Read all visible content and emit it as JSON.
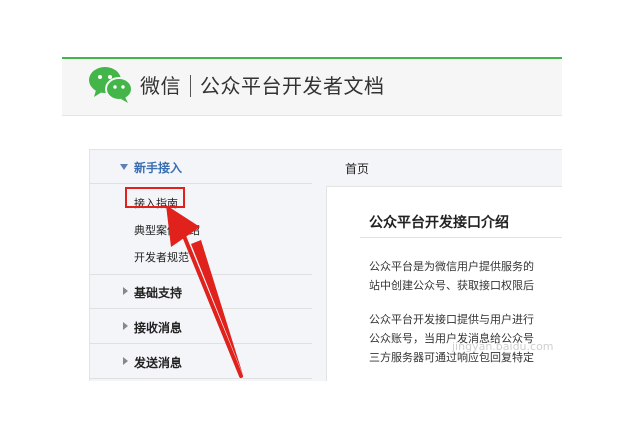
{
  "header": {
    "brand_name": "微信",
    "site_title": "公众平台开发者文档"
  },
  "sidebar": {
    "sections": [
      {
        "label": "新手接入",
        "expanded": true
      },
      {
        "label": "基础支持",
        "expanded": false
      },
      {
        "label": "接收消息",
        "expanded": false
      },
      {
        "label": "发送消息",
        "expanded": false
      }
    ],
    "sub_items": [
      "接入指南",
      "典型案例介绍",
      "开发者规范"
    ],
    "highlighted_item": "接入指南"
  },
  "content": {
    "breadcrumb": "首页",
    "title": "公众平台开发接口介绍",
    "paragraphs": [
      "公众平台是为微信用户提供服务的",
      "站中创建公众号、获取接口权限后",
      "公众平台开发接口提供与用户进行",
      "公众账号，当用户发消息给公众号",
      "三方服务器可通过响应包回复特定"
    ]
  },
  "colors": {
    "brand_green": "#44b549",
    "annotation_red": "#e0211c",
    "menu_blue": "#3a6eb1"
  },
  "icons": {
    "logo": "wechat-logo-icon",
    "expand": "triangle-down-icon",
    "collapse": "triangle-right-icon"
  },
  "watermark": "jingyan.baidu.com"
}
